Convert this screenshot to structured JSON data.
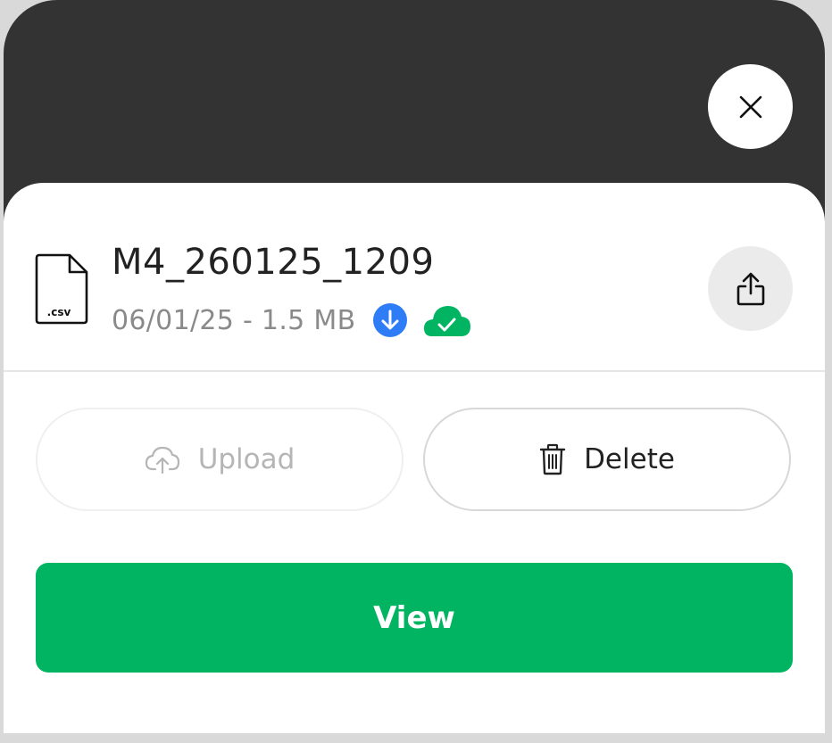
{
  "file": {
    "name": "M4_260125_1209",
    "meta": "06/01/25 - 1.5 MB",
    "extension": ".csv"
  },
  "actions": {
    "upload_label": "Upload",
    "delete_label": "Delete",
    "view_label": "View"
  },
  "icons": {
    "close": "close-icon",
    "share": "share-icon",
    "file": "csv-file-icon",
    "downloaded": "download-status-icon",
    "synced": "cloud-synced-icon",
    "upload": "cloud-upload-icon",
    "delete": "trash-icon"
  },
  "colors": {
    "primary_green": "#00b462",
    "status_blue": "#2f7df6",
    "header_dark": "#333333"
  }
}
